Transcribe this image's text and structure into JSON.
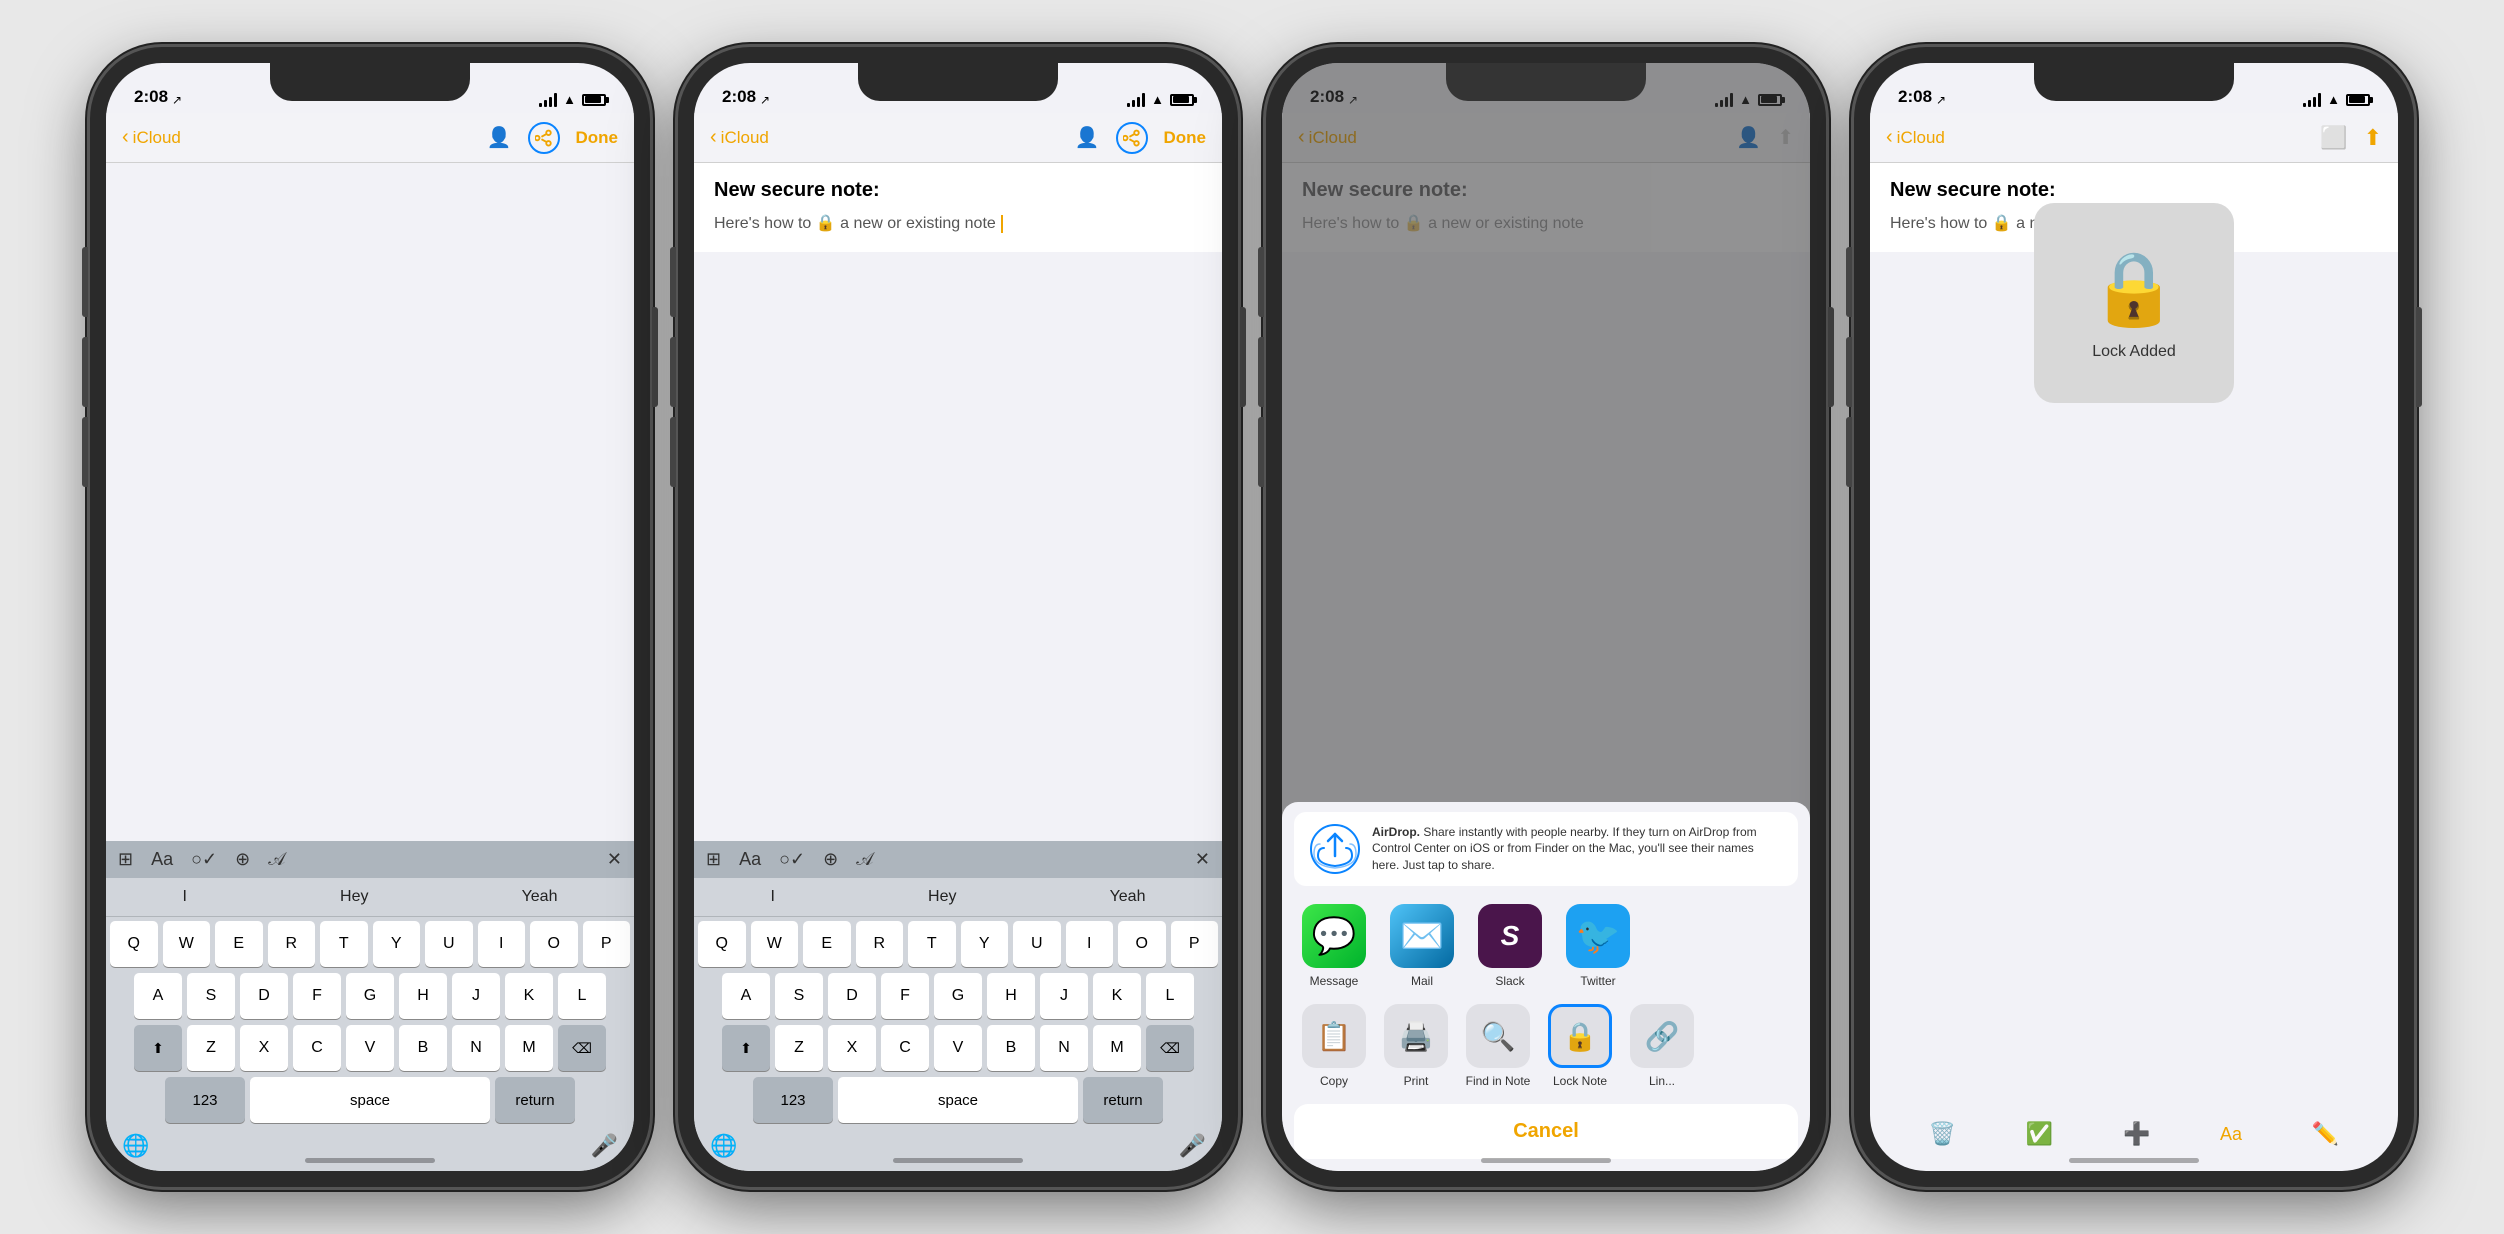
{
  "phones": [
    {
      "id": "phone1",
      "statusBar": {
        "time": "2:08",
        "hasArrow": true
      },
      "navbar": {
        "back": "iCloud",
        "showShareHighlighted": true,
        "showDone": true,
        "doneLabel": "Done"
      },
      "noteTitle": "",
      "noteBody": "",
      "showCursor": false,
      "showKeyboard": true,
      "predictions": [
        "I",
        "Hey",
        "Yeah"
      ],
      "rows": [
        [
          "Q",
          "W",
          "E",
          "R",
          "T",
          "Y",
          "U",
          "I",
          "O",
          "P"
        ],
        [
          "A",
          "S",
          "D",
          "F",
          "G",
          "H",
          "J",
          "K",
          "L"
        ],
        [
          "⬆",
          "Z",
          "X",
          "C",
          "V",
          "B",
          "N",
          "M",
          "⌫"
        ],
        [
          "123",
          "space",
          "return"
        ]
      ]
    },
    {
      "id": "phone2",
      "statusBar": {
        "time": "2:08",
        "hasArrow": true
      },
      "navbar": {
        "back": "iCloud",
        "showShareHighlighted": true,
        "showDone": true,
        "doneLabel": "Done"
      },
      "noteTitle": "New secure note:",
      "noteBody": "Here's how to 🔒 a new or existing note",
      "showCursor": true,
      "showKeyboard": true,
      "predictions": [
        "I",
        "Hey",
        "Yeah"
      ],
      "rows": [
        [
          "Q",
          "W",
          "E",
          "R",
          "T",
          "Y",
          "U",
          "I",
          "O",
          "P"
        ],
        [
          "A",
          "S",
          "D",
          "F",
          "G",
          "H",
          "J",
          "K",
          "L"
        ],
        [
          "⬆",
          "Z",
          "X",
          "C",
          "V",
          "B",
          "N",
          "M",
          "⌫"
        ],
        [
          "123",
          "space",
          "return"
        ]
      ]
    },
    {
      "id": "phone3",
      "statusBar": {
        "time": "2:08",
        "hasArrow": true
      },
      "navbar": {
        "back": "iCloud",
        "showShareHighlighted": false,
        "showDone": false,
        "doneLabel": ""
      },
      "noteTitle": "New secure note:",
      "noteBody": "Here's how to 🔒 a new or existing note",
      "showCursor": false,
      "showKeyboard": false,
      "showShareSheet": true,
      "airdropText": "AirDrop. Share instantly with people nearby. If they turn on AirDrop from Control Center on iOS or from Finder on the Mac, you'll see their names here. Just tap to share.",
      "shareApps": [
        {
          "name": "Message",
          "color": "#3de649",
          "icon": "💬"
        },
        {
          "name": "Mail",
          "color": "#4fc3f7",
          "icon": "✉️"
        },
        {
          "name": "Slack",
          "color": "#4a154b",
          "icon": "S"
        },
        {
          "name": "Twitter",
          "color": "#1da1f2",
          "icon": "🐦"
        }
      ],
      "shareActions": [
        {
          "name": "Copy",
          "icon": "📋",
          "highlighted": false
        },
        {
          "name": "Print",
          "icon": "🖨️",
          "highlighted": false
        },
        {
          "name": "Find in Note",
          "icon": "🔍",
          "highlighted": false
        },
        {
          "name": "Lock Note",
          "icon": "🔒",
          "highlighted": true
        },
        {
          "name": "Lin...",
          "icon": "🔗",
          "highlighted": false
        }
      ],
      "cancelLabel": "Cancel"
    },
    {
      "id": "phone4",
      "statusBar": {
        "time": "2:08",
        "hasArrow": true
      },
      "navbar": {
        "back": "iCloud",
        "showShareHighlighted": false,
        "showDone": false,
        "doneLabel": ""
      },
      "noteTitle": "New secure note:",
      "noteBody": "Here's how to 🔒 a new or existing note",
      "showCursor": false,
      "showKeyboard": false,
      "showLockAdded": true,
      "lockAddedLabel": "Lock Added",
      "bottomToolbarIcons": [
        "🗑️",
        "✅",
        "➕",
        "Aa",
        "✏️"
      ]
    }
  ]
}
